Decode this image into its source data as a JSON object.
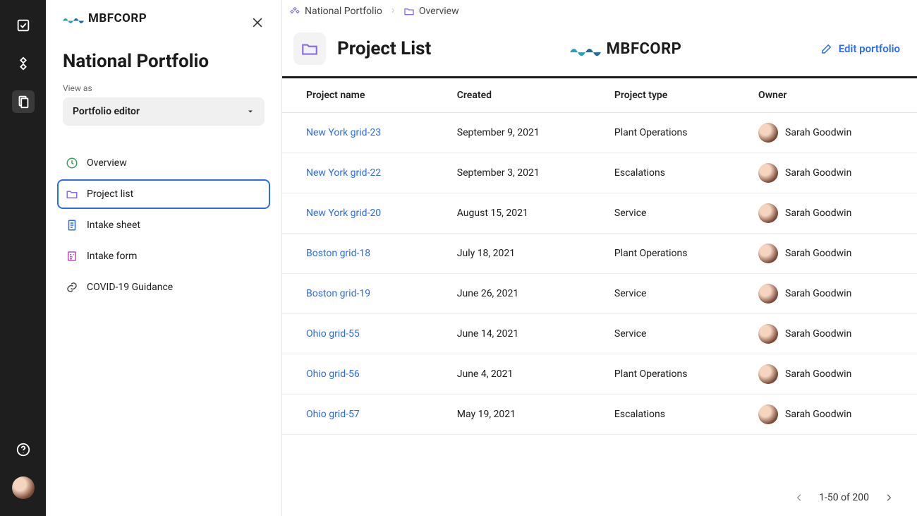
{
  "brand": {
    "name": "MBFCORP"
  },
  "sidebar": {
    "title": "National Portfolio",
    "view_as_label": "View as",
    "role_selected": "Portfolio editor",
    "nav": [
      {
        "id": "overview",
        "label": "Overview"
      },
      {
        "id": "project-list",
        "label": "Project list"
      },
      {
        "id": "intake-sheet",
        "label": "Intake sheet"
      },
      {
        "id": "intake-form",
        "label": "Intake form"
      },
      {
        "id": "covid-guidance",
        "label": "COVID-19 Guidance"
      }
    ]
  },
  "breadcrumbs": {
    "portfolio": "National Portfolio",
    "section": "Overview"
  },
  "page": {
    "title": "Project List",
    "edit_label": "Edit portfolio"
  },
  "table": {
    "columns": {
      "name": "Project name",
      "created": "Created",
      "type": "Project type",
      "owner": "Owner"
    },
    "rows": [
      {
        "name": "New York grid-23",
        "created": "September 9, 2021",
        "type": "Plant Operations",
        "owner": "Sarah Goodwin"
      },
      {
        "name": "New York grid-22",
        "created": "September 3, 2021",
        "type": "Escalations",
        "owner": "Sarah Goodwin"
      },
      {
        "name": "New York grid-20",
        "created": "August 15, 2021",
        "type": "Service",
        "owner": "Sarah Goodwin"
      },
      {
        "name": "Boston grid-18",
        "created": "July 18, 2021",
        "type": "Plant Operations",
        "owner": "Sarah Goodwin"
      },
      {
        "name": "Boston grid-19",
        "created": "June 26, 2021",
        "type": "Service",
        "owner": "Sarah Goodwin"
      },
      {
        "name": "Ohio grid-55",
        "created": "June 14, 2021",
        "type": "Service",
        "owner": "Sarah Goodwin"
      },
      {
        "name": "Ohio grid-56",
        "created": "June 4, 2021",
        "type": "Plant Operations",
        "owner": "Sarah Goodwin"
      },
      {
        "name": "Ohio grid-57",
        "created": "May 19, 2021",
        "type": "Escalations",
        "owner": "Sarah Goodwin"
      }
    ]
  },
  "pager": {
    "range": "1-50 of 200"
  },
  "colors": {
    "link": "#2a6cf0",
    "rail_bg": "#1e1e1e",
    "folder_accent": "#8a6bf0"
  }
}
